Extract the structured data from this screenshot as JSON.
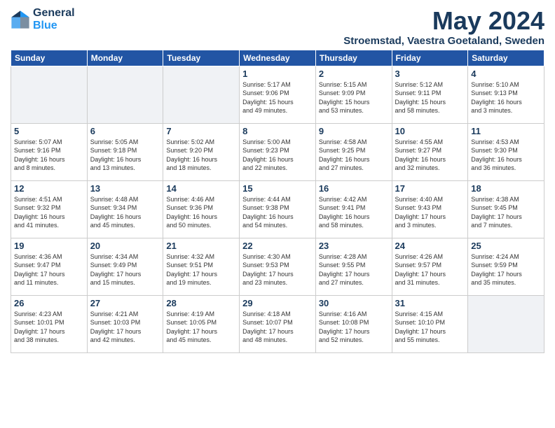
{
  "header": {
    "logo_line1": "General",
    "logo_line2": "Blue",
    "month_year": "May 2024",
    "location": "Stroemstad, Vaestra Goetaland, Sweden"
  },
  "days_of_week": [
    "Sunday",
    "Monday",
    "Tuesday",
    "Wednesday",
    "Thursday",
    "Friday",
    "Saturday"
  ],
  "weeks": [
    [
      {
        "day": "",
        "info": ""
      },
      {
        "day": "",
        "info": ""
      },
      {
        "day": "",
        "info": ""
      },
      {
        "day": "1",
        "info": "Sunrise: 5:17 AM\nSunset: 9:06 PM\nDaylight: 15 hours\nand 49 minutes."
      },
      {
        "day": "2",
        "info": "Sunrise: 5:15 AM\nSunset: 9:09 PM\nDaylight: 15 hours\nand 53 minutes."
      },
      {
        "day": "3",
        "info": "Sunrise: 5:12 AM\nSunset: 9:11 PM\nDaylight: 15 hours\nand 58 minutes."
      },
      {
        "day": "4",
        "info": "Sunrise: 5:10 AM\nSunset: 9:13 PM\nDaylight: 16 hours\nand 3 minutes."
      }
    ],
    [
      {
        "day": "5",
        "info": "Sunrise: 5:07 AM\nSunset: 9:16 PM\nDaylight: 16 hours\nand 8 minutes."
      },
      {
        "day": "6",
        "info": "Sunrise: 5:05 AM\nSunset: 9:18 PM\nDaylight: 16 hours\nand 13 minutes."
      },
      {
        "day": "7",
        "info": "Sunrise: 5:02 AM\nSunset: 9:20 PM\nDaylight: 16 hours\nand 18 minutes."
      },
      {
        "day": "8",
        "info": "Sunrise: 5:00 AM\nSunset: 9:23 PM\nDaylight: 16 hours\nand 22 minutes."
      },
      {
        "day": "9",
        "info": "Sunrise: 4:58 AM\nSunset: 9:25 PM\nDaylight: 16 hours\nand 27 minutes."
      },
      {
        "day": "10",
        "info": "Sunrise: 4:55 AM\nSunset: 9:27 PM\nDaylight: 16 hours\nand 32 minutes."
      },
      {
        "day": "11",
        "info": "Sunrise: 4:53 AM\nSunset: 9:30 PM\nDaylight: 16 hours\nand 36 minutes."
      }
    ],
    [
      {
        "day": "12",
        "info": "Sunrise: 4:51 AM\nSunset: 9:32 PM\nDaylight: 16 hours\nand 41 minutes."
      },
      {
        "day": "13",
        "info": "Sunrise: 4:48 AM\nSunset: 9:34 PM\nDaylight: 16 hours\nand 45 minutes."
      },
      {
        "day": "14",
        "info": "Sunrise: 4:46 AM\nSunset: 9:36 PM\nDaylight: 16 hours\nand 50 minutes."
      },
      {
        "day": "15",
        "info": "Sunrise: 4:44 AM\nSunset: 9:38 PM\nDaylight: 16 hours\nand 54 minutes."
      },
      {
        "day": "16",
        "info": "Sunrise: 4:42 AM\nSunset: 9:41 PM\nDaylight: 16 hours\nand 58 minutes."
      },
      {
        "day": "17",
        "info": "Sunrise: 4:40 AM\nSunset: 9:43 PM\nDaylight: 17 hours\nand 3 minutes."
      },
      {
        "day": "18",
        "info": "Sunrise: 4:38 AM\nSunset: 9:45 PM\nDaylight: 17 hours\nand 7 minutes."
      }
    ],
    [
      {
        "day": "19",
        "info": "Sunrise: 4:36 AM\nSunset: 9:47 PM\nDaylight: 17 hours\nand 11 minutes."
      },
      {
        "day": "20",
        "info": "Sunrise: 4:34 AM\nSunset: 9:49 PM\nDaylight: 17 hours\nand 15 minutes."
      },
      {
        "day": "21",
        "info": "Sunrise: 4:32 AM\nSunset: 9:51 PM\nDaylight: 17 hours\nand 19 minutes."
      },
      {
        "day": "22",
        "info": "Sunrise: 4:30 AM\nSunset: 9:53 PM\nDaylight: 17 hours\nand 23 minutes."
      },
      {
        "day": "23",
        "info": "Sunrise: 4:28 AM\nSunset: 9:55 PM\nDaylight: 17 hours\nand 27 minutes."
      },
      {
        "day": "24",
        "info": "Sunrise: 4:26 AM\nSunset: 9:57 PM\nDaylight: 17 hours\nand 31 minutes."
      },
      {
        "day": "25",
        "info": "Sunrise: 4:24 AM\nSunset: 9:59 PM\nDaylight: 17 hours\nand 35 minutes."
      }
    ],
    [
      {
        "day": "26",
        "info": "Sunrise: 4:23 AM\nSunset: 10:01 PM\nDaylight: 17 hours\nand 38 minutes."
      },
      {
        "day": "27",
        "info": "Sunrise: 4:21 AM\nSunset: 10:03 PM\nDaylight: 17 hours\nand 42 minutes."
      },
      {
        "day": "28",
        "info": "Sunrise: 4:19 AM\nSunset: 10:05 PM\nDaylight: 17 hours\nand 45 minutes."
      },
      {
        "day": "29",
        "info": "Sunrise: 4:18 AM\nSunset: 10:07 PM\nDaylight: 17 hours\nand 48 minutes."
      },
      {
        "day": "30",
        "info": "Sunrise: 4:16 AM\nSunset: 10:08 PM\nDaylight: 17 hours\nand 52 minutes."
      },
      {
        "day": "31",
        "info": "Sunrise: 4:15 AM\nSunset: 10:10 PM\nDaylight: 17 hours\nand 55 minutes."
      },
      {
        "day": "",
        "info": ""
      }
    ]
  ]
}
